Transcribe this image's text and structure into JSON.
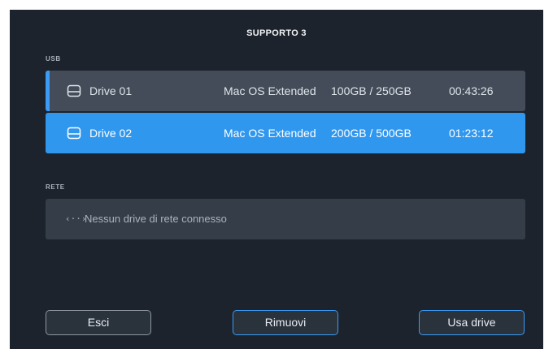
{
  "dialog": {
    "title": "SUPPORTO 3"
  },
  "usb": {
    "section_label": "USB",
    "drives": [
      {
        "icon": "drive-icon",
        "name": "Drive 01",
        "format": "Mac OS Extended",
        "capacity": "100GB / 250GB",
        "time_remaining": "00:43:26",
        "selected": false
      },
      {
        "icon": "drive-icon",
        "name": "Drive 02",
        "format": "Mac OS Extended",
        "capacity": "200GB / 500GB",
        "time_remaining": "01:23:12",
        "selected": true
      }
    ]
  },
  "network": {
    "section_label": "RETE",
    "icon": "network-link-icon",
    "icon_glyph": "‹··›",
    "empty_message": "Nessun drive di rete connesso"
  },
  "buttons": {
    "exit_label": "Esci",
    "remove_label": "Rimuovi",
    "use_drive_label": "Usa drive"
  },
  "colors": {
    "background": "#1c232c",
    "row": "#434c58",
    "selected_row": "#3097ef",
    "accent": "#3b9bf5",
    "network_row": "#353d48"
  }
}
